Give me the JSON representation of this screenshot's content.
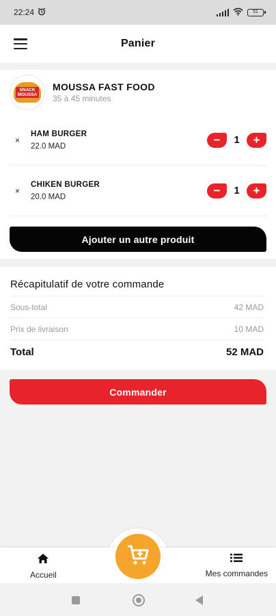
{
  "status_bar": {
    "time": "22:24",
    "battery": "51"
  },
  "header": {
    "title": "Panier"
  },
  "restaurant": {
    "name": "MOUSSA FAST FOOD",
    "eta": "35 à 45 minutes",
    "logo_text": "SNACK MOUSSA"
  },
  "cart": {
    "items": [
      {
        "remove": "×",
        "name": "HAM BURGER",
        "price": "22.0 MAD",
        "qty": "1"
      },
      {
        "remove": "×",
        "name": "CHIKEN BURGER",
        "price": "20.0 MAD",
        "qty": "1"
      }
    ],
    "minus_label": "−",
    "plus_label": "+",
    "add_button": "Ajouter un autre produit"
  },
  "summary": {
    "title": "Récapitulatif de votre commande",
    "subtotal_label": "Sous-total",
    "subtotal_value": "42 MAD",
    "delivery_label": "Prix de livraison",
    "delivery_value": "10 MAD",
    "total_label": "Total",
    "total_value": "52 MAD"
  },
  "order_button": "Commander",
  "bottom_nav": {
    "home_label": "Accueil",
    "orders_label": "Mes commandes"
  },
  "colors": {
    "accent_red": "#e8232b",
    "fab_orange": "#f5a42c",
    "dark_button": "#050505"
  }
}
